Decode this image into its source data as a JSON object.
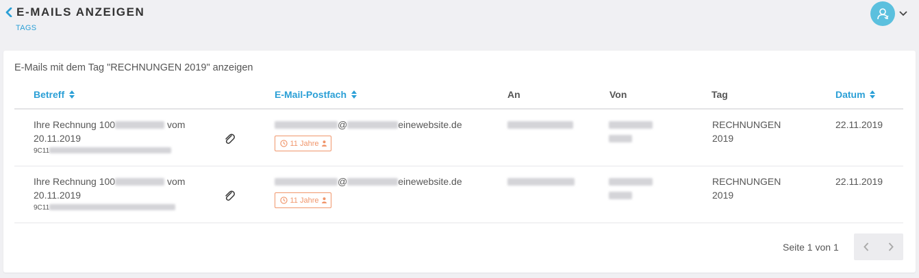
{
  "header": {
    "title": "E-MAILS ANZEIGEN",
    "breadcrumb": "TAGS"
  },
  "card": {
    "heading": "E-Mails mit dem Tag \"RECHNUNGEN 2019\" anzeigen"
  },
  "table": {
    "columns": {
      "subject": "Betreff",
      "mailbox": "E-Mail-Postfach",
      "to": "An",
      "from": "Von",
      "tag": "Tag",
      "date": "Datum"
    },
    "rows": [
      {
        "subject_prefix": "Ihre Rechnung 100",
        "subject_suffix": "vom",
        "subject_line2": "20.11.2019",
        "id_prefix": "9C11",
        "mailbox_suffix": "einewebsite.de",
        "mailbox_at": "@",
        "age": "11 Jahre",
        "tag_line1": "RECHNUNGEN",
        "tag_line2": "2019",
        "date": "22.11.2019"
      },
      {
        "subject_prefix": "Ihre Rechnung 100",
        "subject_suffix": "vom",
        "subject_line2": "20.11.2019",
        "id_prefix": "9C11",
        "mailbox_suffix": "einewebsite.de",
        "mailbox_at": "@",
        "age": "11 Jahre",
        "tag_line1": "RECHNUNGEN",
        "tag_line2": "2019",
        "date": "22.11.2019"
      }
    ]
  },
  "pagination": {
    "text": "Seite 1 von 1"
  },
  "colors": {
    "accent": "#2a9fd6",
    "badge": "#f0956a",
    "avatar": "#5bc0de"
  },
  "icons": {
    "back": "chevron-left-icon",
    "avatar": "user-icon",
    "caret": "chevron-down-icon",
    "sort": "sort-icon",
    "attachment": "paperclip-icon",
    "clock": "clock-icon",
    "person": "person-icon",
    "prev": "chevron-left-icon",
    "next": "chevron-right-icon"
  }
}
